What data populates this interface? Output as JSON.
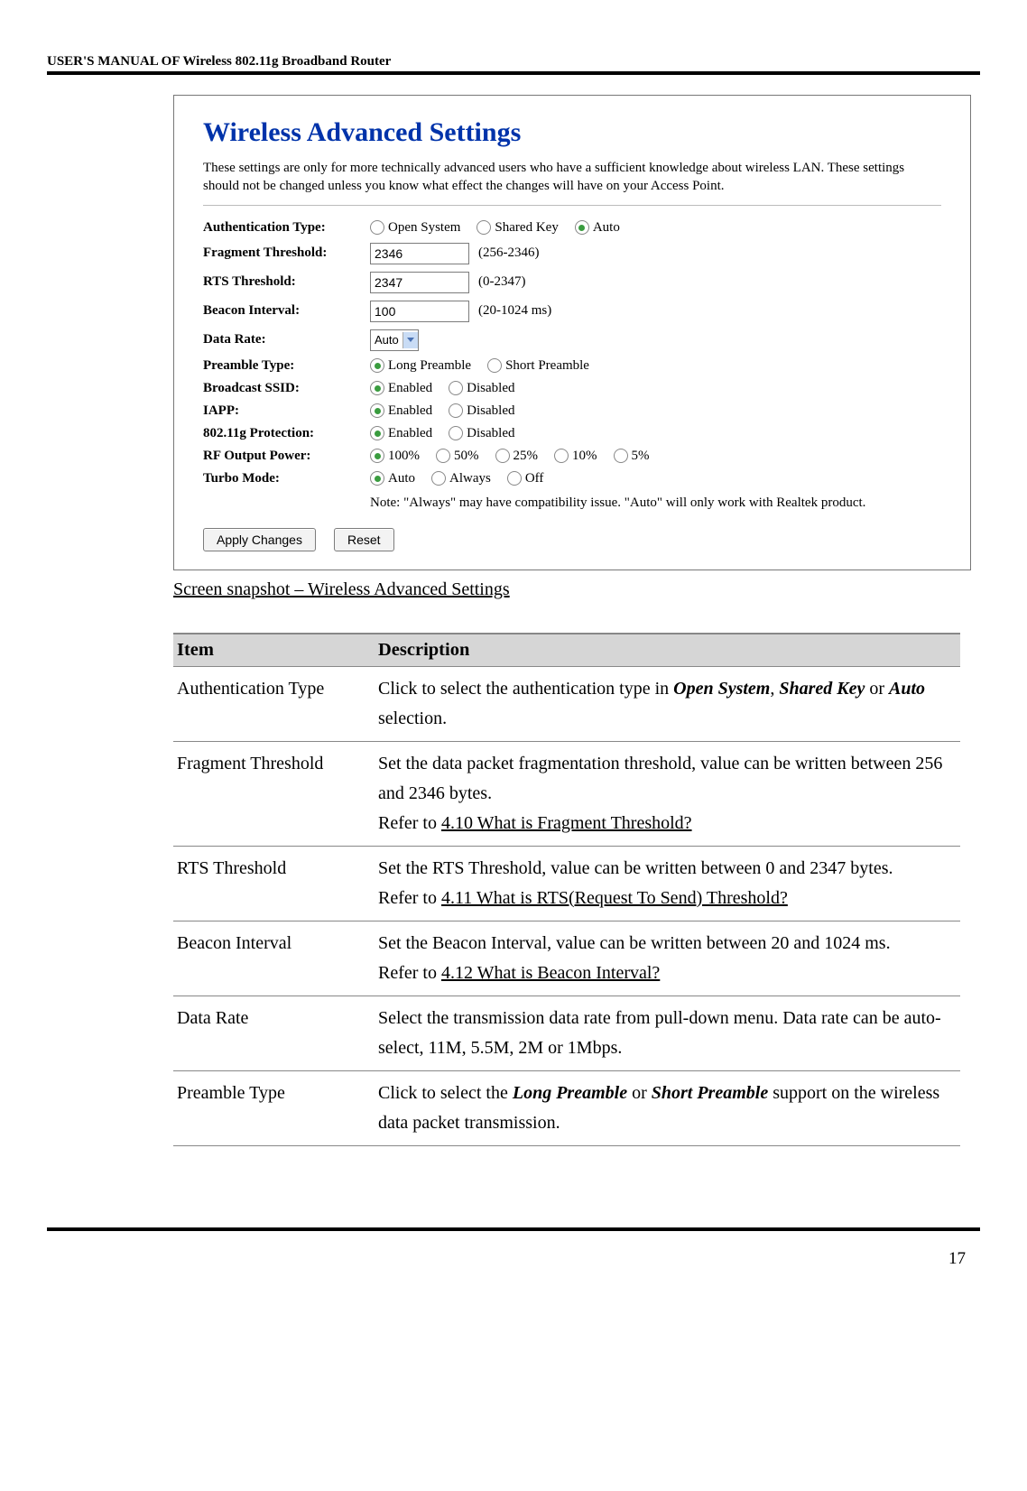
{
  "header": "USER'S MANUAL OF Wireless 802.11g Broadband Router",
  "screenshot": {
    "title": "Wireless Advanced Settings",
    "description": "These settings are only for more technically advanced users who have a sufficient knowledge about wireless LAN. These settings should not be changed unless you know what effect the changes will have on your Access Point.",
    "rows": {
      "auth_type": {
        "label": "Authentication Type:",
        "options": [
          "Open System",
          "Shared Key",
          "Auto"
        ],
        "selected": "Auto"
      },
      "fragment_threshold": {
        "label": "Fragment Threshold:",
        "value": "2346",
        "range": "(256-2346)"
      },
      "rts_threshold": {
        "label": "RTS Threshold:",
        "value": "2347",
        "range": "(0-2347)"
      },
      "beacon_interval": {
        "label": "Beacon Interval:",
        "value": "100",
        "range": "(20-1024 ms)"
      },
      "data_rate": {
        "label": "Data Rate:",
        "value": "Auto"
      },
      "preamble_type": {
        "label": "Preamble Type:",
        "options": [
          "Long Preamble",
          "Short Preamble"
        ],
        "selected": "Long Preamble"
      },
      "broadcast_ssid": {
        "label": "Broadcast SSID:",
        "options": [
          "Enabled",
          "Disabled"
        ],
        "selected": "Enabled"
      },
      "iapp": {
        "label": "IAPP:",
        "options": [
          "Enabled",
          "Disabled"
        ],
        "selected": "Enabled"
      },
      "protection": {
        "label": "802.11g Protection:",
        "options": [
          "Enabled",
          "Disabled"
        ],
        "selected": "Enabled"
      },
      "rf_output_power": {
        "label": "RF Output Power:",
        "options": [
          "100%",
          "50%",
          "25%",
          "10%",
          "5%"
        ],
        "selected": "100%"
      },
      "turbo_mode": {
        "label": "Turbo Mode:",
        "options": [
          "Auto",
          "Always",
          "Off"
        ],
        "selected": "Auto",
        "note": "Note: \"Always\" may have compatibility issue. \"Auto\" will only work with Realtek product."
      }
    },
    "buttons": {
      "apply": "Apply Changes",
      "reset": "Reset"
    }
  },
  "caption": "Screen snapshot – Wireless Advanced Settings",
  "table": {
    "headers": {
      "item": "Item",
      "desc": "Description"
    },
    "rows": [
      {
        "item": "Authentication Type",
        "desc_html": "Click to select the authentication type in <b><i>Open System</i></b>, <b><i>Shared Key</i></b> or <b><i>Auto</i></b> selection."
      },
      {
        "item": "Fragment Threshold",
        "desc_html": "Set the data packet fragmentation threshold, value can be written between 256 and 2346 bytes.<br>Refer to <u>4.10 What is Fragment Threshold?</u>"
      },
      {
        "item": "RTS Threshold",
        "desc_html": "Set the RTS Threshold, value can be written between 0 and 2347 bytes.<br>Refer to <u>4.11 What is RTS(Request To Send) Threshold?</u>"
      },
      {
        "item": "Beacon Interval",
        "desc_html": "Set the Beacon Interval, value can be written between 20 and 1024 ms.<br>Refer to <u>4.12 What is Beacon Interval?</u>"
      },
      {
        "item": "Data Rate",
        "desc_html": "Select the transmission data rate from pull-down menu. Data rate can be auto-select, 11M, 5.5M, 2M or 1Mbps."
      },
      {
        "item": "Preamble Type",
        "desc_html": "Click to select the <b><i>Long Preamble</i></b> or <b><i>Short Preamble</i></b> support on the wireless data packet transmission."
      }
    ]
  },
  "page_number": "17"
}
